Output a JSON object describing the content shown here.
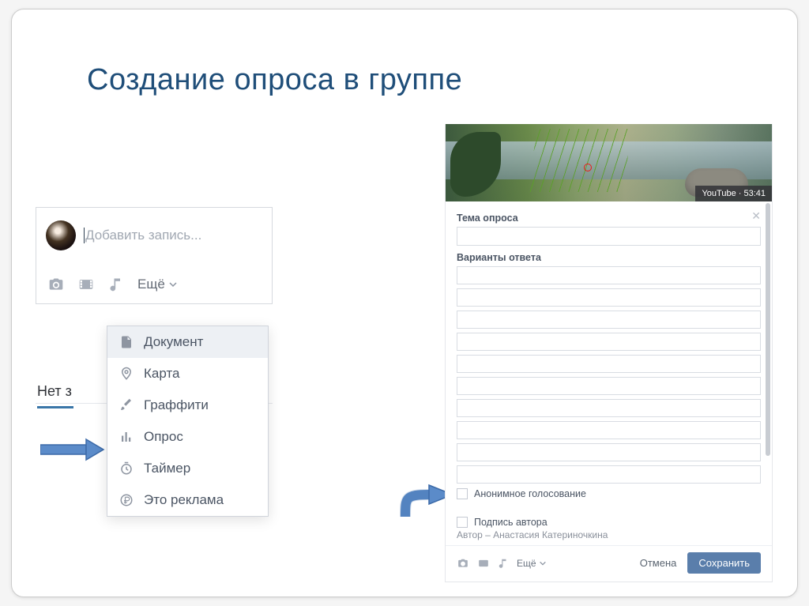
{
  "slide_title": "Создание опроса в группе",
  "composer": {
    "placeholder": "Добавить запись...",
    "more_label": "Ещё",
    "no_posts_fragment": "Нет з"
  },
  "dropdown": {
    "items": [
      {
        "icon": "document-icon",
        "label": "Документ"
      },
      {
        "icon": "map-pin-icon",
        "label": "Карта"
      },
      {
        "icon": "brush-icon",
        "label": "Граффити"
      },
      {
        "icon": "poll-icon",
        "label": "Опрос"
      },
      {
        "icon": "timer-icon",
        "label": "Таймер"
      },
      {
        "icon": "ruble-icon",
        "label": "Это реклама"
      }
    ]
  },
  "right_panel": {
    "video_badge": "YouTube · 53:41",
    "poll_subject_label": "Тема опроса",
    "answers_label": "Варианты ответа",
    "anonymous_label": "Анонимное голосование",
    "author_sign_label": "Подпись автора",
    "author_line": "Автор – Анастасия Катериночкина",
    "footer_more": "Ещё",
    "cancel": "Отмена",
    "save": "Сохранить",
    "option_count": 10
  }
}
